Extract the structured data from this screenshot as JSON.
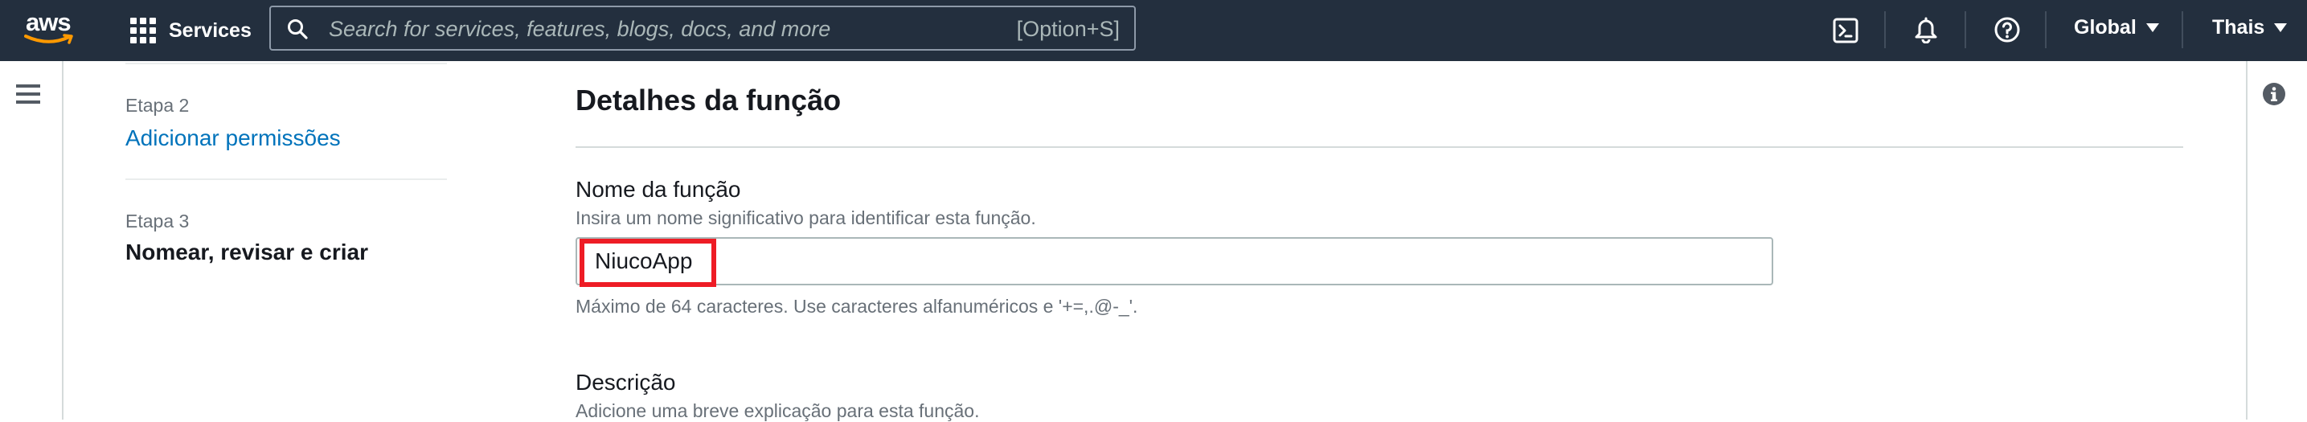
{
  "topnav": {
    "logo_text": "aws",
    "services_label": "Services",
    "search_placeholder": "Search for services, features, blogs, docs, and more",
    "search_shortcut": "[Option+S]",
    "icons": [
      "cloudshell-icon",
      "bell-icon",
      "help-icon"
    ],
    "region_label": "Global",
    "user_label": "Thais",
    "background_color": "#232f3e"
  },
  "steps": [
    {
      "step": "Etapa 2",
      "label": "Adicionar permissões",
      "state": "link"
    },
    {
      "step": "Etapa 3",
      "label": "Nomear, revisar e criar",
      "state": "current"
    }
  ],
  "main": {
    "section_title": "Detalhes da função",
    "name_field": {
      "label": "Nome da função",
      "description": "Insira um nome significativo para identificar esta função.",
      "value": "NiucoApp",
      "constraint": "Máximo de 64 caracteres. Use caracteres alfanuméricos e '+=,.@-_'."
    },
    "description_field": {
      "label": "Descrição",
      "description": "Adicione uma breve explicação para esta função."
    }
  },
  "colors": {
    "link": "#0073bb",
    "highlight": "#ee1c25",
    "secondary_text": "#687078"
  }
}
